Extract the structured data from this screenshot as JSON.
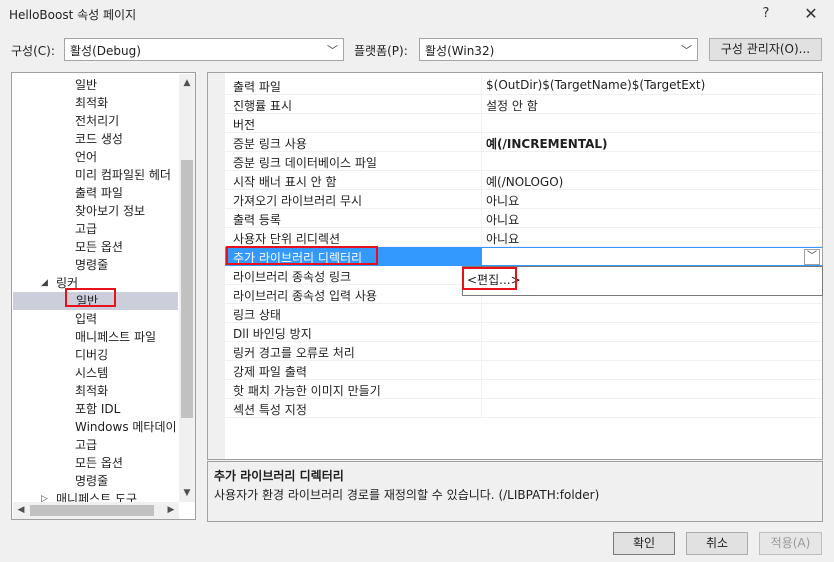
{
  "window": {
    "title": "HelloBoost 속성 페이지",
    "help": "?",
    "close": "✕"
  },
  "config": {
    "label": "구성(C):",
    "value": "활성(Debug)"
  },
  "platform": {
    "label": "플랫폼(P):",
    "value": "활성(Win32)"
  },
  "config_manager": "구성 관리자(O)...",
  "tree": {
    "items": [
      {
        "label": "일반",
        "level": 2
      },
      {
        "label": "최적화",
        "level": 2
      },
      {
        "label": "전처리기",
        "level": 2
      },
      {
        "label": "코드 생성",
        "level": 2
      },
      {
        "label": "언어",
        "level": 2
      },
      {
        "label": "미리 컴파일된 헤더",
        "level": 2
      },
      {
        "label": "출력 파일",
        "level": 2
      },
      {
        "label": "찾아보기 정보",
        "level": 2
      },
      {
        "label": "고급",
        "level": 2
      },
      {
        "label": "모든 옵션",
        "level": 2
      },
      {
        "label": "명령줄",
        "level": 2
      },
      {
        "label": "링커",
        "level": 1,
        "expander": "◢"
      },
      {
        "label": "일반",
        "level": 2,
        "selected": true
      },
      {
        "label": "입력",
        "level": 2
      },
      {
        "label": "매니페스트 파일",
        "level": 2
      },
      {
        "label": "디버깅",
        "level": 2
      },
      {
        "label": "시스템",
        "level": 2
      },
      {
        "label": "최적화",
        "level": 2
      },
      {
        "label": "포함 IDL",
        "level": 2
      },
      {
        "label": "Windows 메타데이",
        "level": 2
      },
      {
        "label": "고급",
        "level": 2
      },
      {
        "label": "모든 옵션",
        "level": 2
      },
      {
        "label": "명령줄",
        "level": 2
      },
      {
        "label": "매니페스트 도구",
        "level": 1,
        "expander": "▷"
      }
    ]
  },
  "properties": [
    {
      "name": "출력 파일",
      "value": "$(OutDir)$(TargetName)$(TargetExt)"
    },
    {
      "name": "진행률 표시",
      "value": "설정 안 함"
    },
    {
      "name": "버전",
      "value": ""
    },
    {
      "name": "증분 링크 사용",
      "value": "예(/INCREMENTAL)",
      "bold": true
    },
    {
      "name": "증분 링크 데이터베이스 파일",
      "value": ""
    },
    {
      "name": "시작 배너 표시 안 함",
      "value": "예(/NOLOGO)"
    },
    {
      "name": "가져오기 라이브러리 무시",
      "value": "아니요"
    },
    {
      "name": "출력 등록",
      "value": "아니요"
    },
    {
      "name": "사용자 단위 리디렉션",
      "value": "아니요"
    },
    {
      "name": "추가 라이브러리 디렉터리",
      "value": "",
      "active": true
    },
    {
      "name": "라이브러리 종속성 링크",
      "value": ""
    },
    {
      "name": "라이브러리 종속성 입력 사용",
      "value": ""
    },
    {
      "name": "링크 상태",
      "value": ""
    },
    {
      "name": "Dll 바인딩 방지",
      "value": ""
    },
    {
      "name": "링커 경고를 오류로 처리",
      "value": ""
    },
    {
      "name": "강제 파일 출력",
      "value": ""
    },
    {
      "name": "핫 패치 가능한 이미지 만들기",
      "value": ""
    },
    {
      "name": "섹션 특성 지정",
      "value": ""
    }
  ],
  "dropdown": {
    "option": "<편집...>"
  },
  "description": {
    "title": "추가 라이브러리 디렉터리",
    "text": "사용자가 환경 라이브러리 경로를 재정의할 수 있습니다. (/LIBPATH:folder)"
  },
  "buttons": {
    "ok": "확인",
    "cancel": "취소",
    "apply": "적용(A)"
  },
  "colors": {
    "selection": "#3399ff",
    "highlight_box": "#e8101a",
    "tree_selection": "#cccedb"
  }
}
